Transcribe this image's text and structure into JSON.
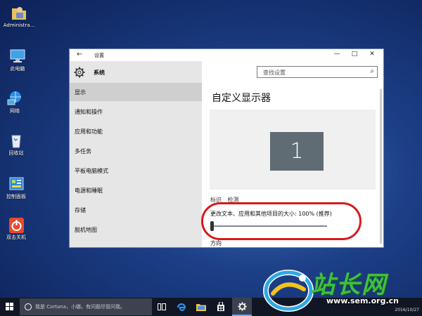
{
  "desktop": {
    "icons": [
      {
        "label": "Administra..."
      },
      {
        "label": "此电脑"
      },
      {
        "label": "网络"
      },
      {
        "label": "回收站"
      },
      {
        "label": "控制面板"
      },
      {
        "label": "双击关机"
      }
    ]
  },
  "window": {
    "title": "设置",
    "back_glyph": "←",
    "minimize_glyph": "—",
    "maximize_glyph": "□",
    "close_glyph": "✕"
  },
  "sidebar": {
    "heading": "系统",
    "items": [
      {
        "label": "显示",
        "active": true
      },
      {
        "label": "通知和操作"
      },
      {
        "label": "应用和功能"
      },
      {
        "label": "多任务"
      },
      {
        "label": "平板电脑模式"
      },
      {
        "label": "电源和睡眠"
      },
      {
        "label": "存储"
      },
      {
        "label": "脱机地图"
      }
    ]
  },
  "search": {
    "placeholder": "查找设置"
  },
  "content": {
    "title": "自定义显示器",
    "monitor_number": "1",
    "identify_link": "标识",
    "detect_link": "检测",
    "scale_label": "更改文本、应用和其他项目的大小: 100% (推荐)",
    "scale_value_percent": 100,
    "orientation_label": "方向"
  },
  "taskbar": {
    "cortana_text": "我是 Cortana，小娜。有问题尽管问我。",
    "date": "2016/10/27"
  },
  "watermark": {
    "word": "站长网",
    "url": "www.sem.org.cn"
  },
  "colors": {
    "accent": "#d81a1a",
    "monitor": "#5f6c73",
    "sidebar_bg": "#e6e6e6"
  }
}
